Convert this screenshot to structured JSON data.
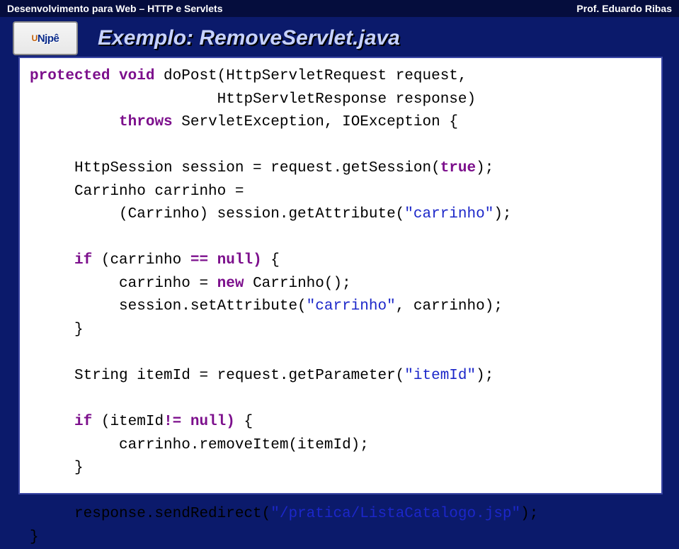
{
  "topbar": {
    "left": "Desenvolvimento para Web – HTTP e Servlets",
    "right": "Prof. Eduardo Ribas"
  },
  "logo": {
    "orange": "U",
    "blue": "Njpê"
  },
  "title": "Exemplo: RemoveServlet.java",
  "code": {
    "l1a": "protected void",
    "l1b": " doPost(HttpServletRequest request,",
    "l2": "                     HttpServletResponse response)",
    "l3a": "          ",
    "l3b": "throws",
    "l3c": " ServletException, IOException {",
    "l4": "",
    "l5a": "     HttpSession session = request.getSession(",
    "l5b": "true",
    "l5c": ");",
    "l6": "     Carrinho carrinho =",
    "l7a": "          (Carrinho) session.getAttribute(",
    "l7b": "\"carrinho\"",
    "l7c": ");",
    "l8": "",
    "l9a": "     ",
    "l9b": "if",
    "l9c": " (carrinho ",
    "l9d": "== null)",
    "l9e": " {",
    "l10a": "          carrinho = ",
    "l10b": "new",
    "l10c": " Carrinho();",
    "l11a": "          session.setAttribute(",
    "l11b": "\"carrinho\"",
    "l11c": ", carrinho);",
    "l12": "     }",
    "l13": "",
    "l14a": "     String itemId = request.getParameter(",
    "l14b": "\"itemId\"",
    "l14c": ");",
    "l15": "",
    "l16a": "     ",
    "l16b": "if",
    "l16c": " (itemId",
    "l16d": "!= null)",
    "l16e": " {",
    "l17": "          carrinho.removeItem(itemId);",
    "l18": "     }",
    "l19": "",
    "l20a": "     response.sendRedirect(",
    "l20b": "\"/pratica/ListaCatalogo.jsp\"",
    "l20c": ");",
    "l21": "}"
  }
}
